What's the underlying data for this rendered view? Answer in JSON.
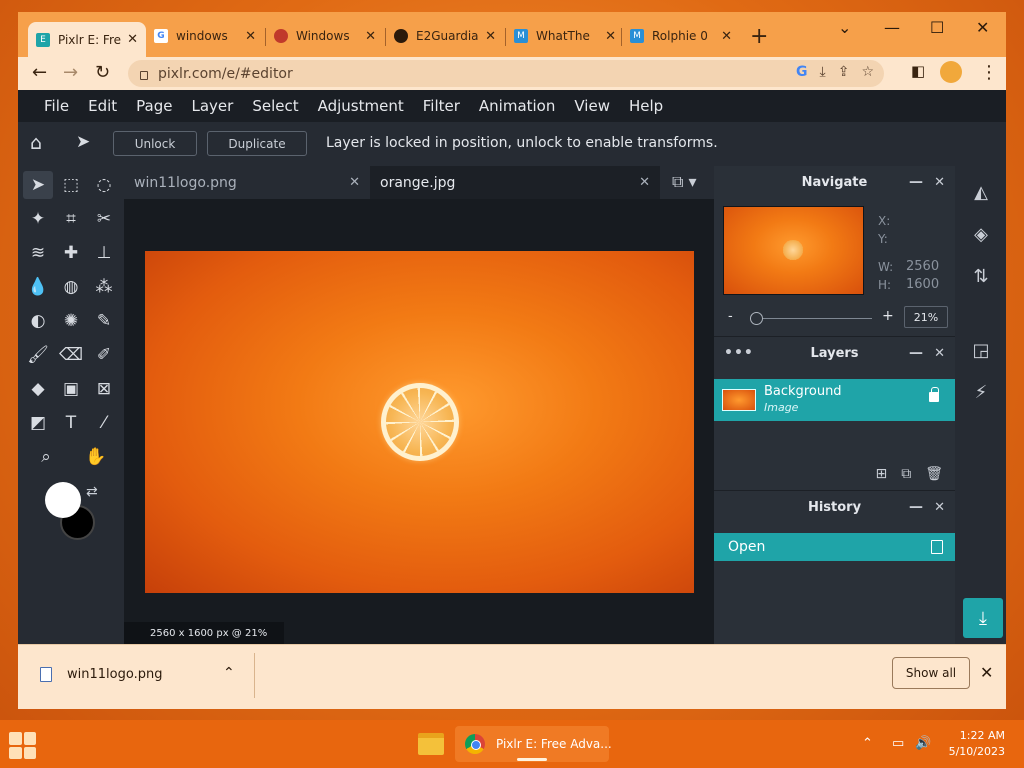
{
  "browser": {
    "tabs": [
      {
        "title": "Pixlr E: Fre",
        "icon": "pixlr-icon",
        "active": true
      },
      {
        "title": "windows",
        "icon": "google-icon",
        "active": false
      },
      {
        "title": "Windows",
        "icon": "flame-icon",
        "active": false
      },
      {
        "title": "E2Guardia",
        "icon": "globe-icon",
        "active": false
      },
      {
        "title": "WhatThe",
        "icon": "whatthe-icon",
        "active": false
      },
      {
        "title": "Rolphie 0",
        "icon": "rolphie-icon",
        "active": false
      }
    ],
    "new_tab": "+",
    "url": "pixlr.com/e/#editor",
    "window_controls": [
      "chevron-down",
      "minimize",
      "maximize",
      "close"
    ]
  },
  "pixlr": {
    "menu": [
      "File",
      "Edit",
      "Page",
      "Layer",
      "Select",
      "Adjustment",
      "Filter",
      "Animation",
      "View",
      "Help"
    ],
    "options": {
      "unlock_label": "Unlock",
      "duplicate_label": "Duplicate",
      "message": "Layer is locked in position, unlock to enable transforms."
    },
    "doc_tabs": [
      {
        "name": "win11logo.png",
        "active": false
      },
      {
        "name": "orange.jpg",
        "active": true
      }
    ],
    "status": "2560 x 1600 px @ 21%",
    "navigate": {
      "title": "Navigate",
      "x_label": "X:",
      "y_label": "Y:",
      "w_label": "W:",
      "h_label": "H:",
      "w_value": "2560",
      "h_value": "1600",
      "zoom_minus": "-",
      "zoom_plus": "+",
      "zoom_value": "21%",
      "zoom_fraction": 0.03
    },
    "layers": {
      "title": "Layers",
      "items": [
        {
          "name": "Background",
          "type": "Image",
          "locked": true
        }
      ]
    },
    "history": {
      "title": "History",
      "items": [
        "Open"
      ]
    }
  },
  "download_bar": {
    "file": "win11logo.png",
    "show_all": "Show all"
  },
  "taskbar": {
    "app_label": "Pixlr E: Free Adva...",
    "time": "1:22 AM",
    "date": "5/10/2023"
  },
  "colors": {
    "accent": "#1fa4a8",
    "app_bg": "#1f242b",
    "taskbar": "#e8660e",
    "tabstrip": "#f6a04a"
  }
}
